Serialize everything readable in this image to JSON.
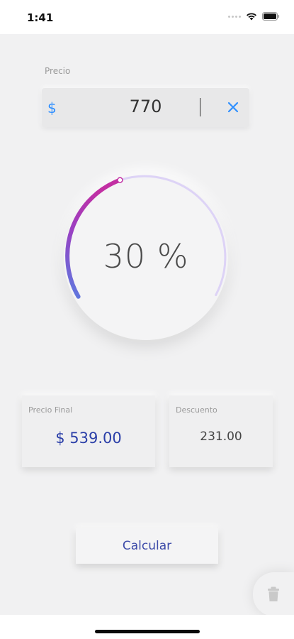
{
  "status_bar": {
    "time": "1:41"
  },
  "price": {
    "label": "Precio",
    "currency_symbol": "$",
    "value": "770",
    "clear_icon": "close-icon"
  },
  "discount_dial": {
    "value_text": "30 %",
    "percent": 30,
    "colors": {
      "gradient_start": "#5b7be0",
      "gradient_end": "#c22fa3",
      "track": "#ddd3f6"
    }
  },
  "results": {
    "final_price": {
      "label": "Precio Final",
      "value": "$ 539.00"
    },
    "discount": {
      "label": "Descuento",
      "value": "231.00"
    }
  },
  "actions": {
    "calculate_label": "Calcular",
    "delete_icon": "trash-icon"
  },
  "colors": {
    "accent_blue": "#2f8fff",
    "result_blue": "#2b3fa8",
    "background": "#f1f1f2"
  }
}
